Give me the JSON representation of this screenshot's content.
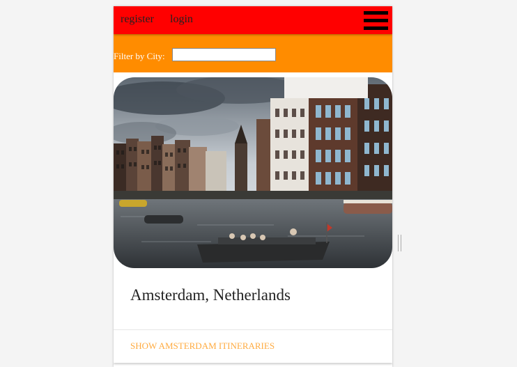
{
  "topbar": {
    "register_label": "register",
    "login_label": "login",
    "menu_icon": "hamburger-menu-icon",
    "background": "#ff0000"
  },
  "filter": {
    "label": "Filter by City:",
    "value": "",
    "placeholder": "",
    "background": "#ff8c00"
  },
  "cities": [
    {
      "title": "Amsterdam, Netherlands",
      "action_label": "SHOW AMSTERDAM ITINERARIES",
      "action_color": "#ffab40"
    }
  ]
}
